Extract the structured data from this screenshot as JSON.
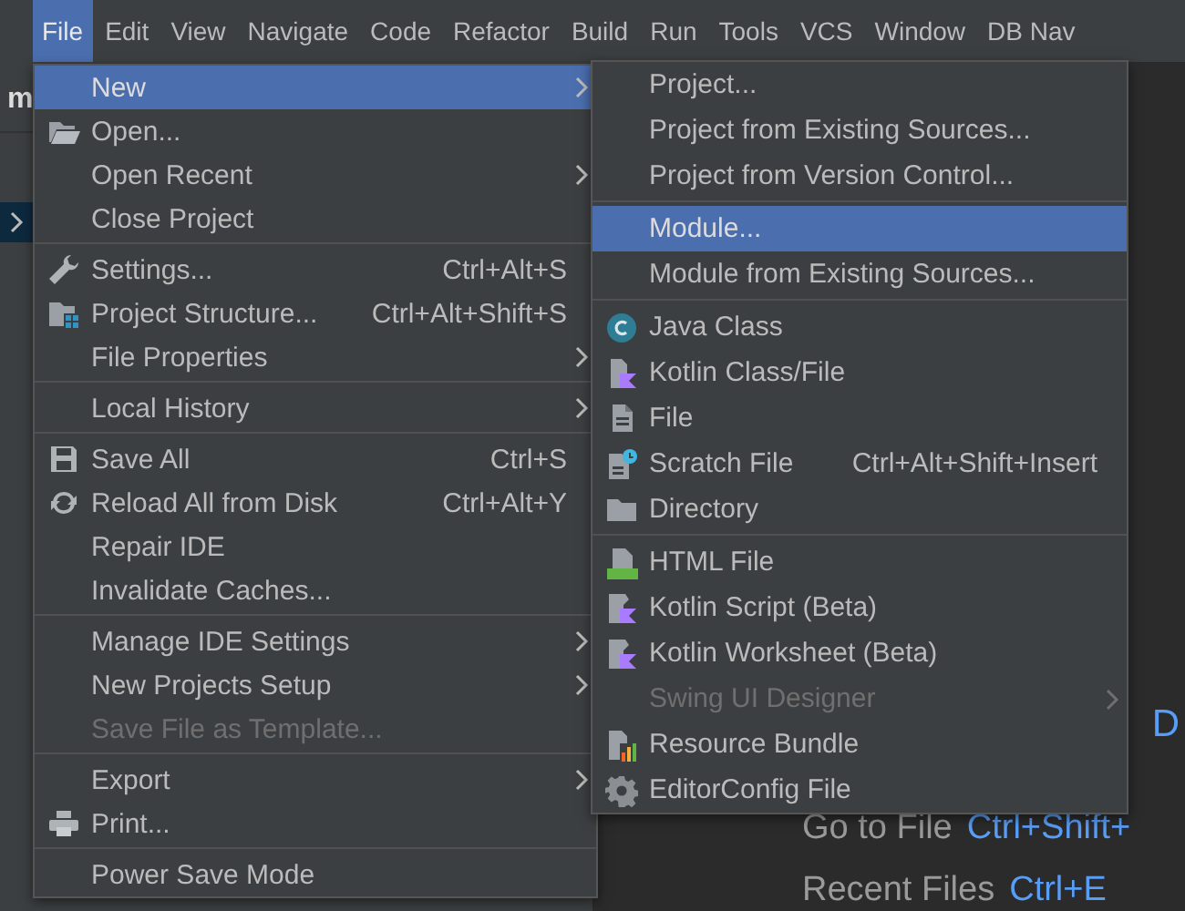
{
  "menu_bar": [
    {
      "label": "File",
      "selected": true
    },
    {
      "label": "Edit",
      "selected": false
    },
    {
      "label": "View",
      "selected": false
    },
    {
      "label": "Navigate",
      "selected": false
    },
    {
      "label": "Code",
      "selected": false
    },
    {
      "label": "Refactor",
      "selected": false
    },
    {
      "label": "Build",
      "selected": false
    },
    {
      "label": "Run",
      "selected": false
    },
    {
      "label": "Tools",
      "selected": false
    },
    {
      "label": "VCS",
      "selected": false
    },
    {
      "label": "Window",
      "selected": false
    },
    {
      "label": "DB Nav",
      "selected": false
    }
  ],
  "project_panel": {
    "title": "m"
  },
  "file_menu": [
    {
      "kind": "item",
      "label": "New",
      "submenu": true,
      "selected": true,
      "disabled": false
    },
    {
      "kind": "item",
      "label": "Open...",
      "selected": false,
      "disabled": false
    },
    {
      "kind": "item",
      "label": "Open Recent",
      "submenu": true,
      "selected": false,
      "disabled": false
    },
    {
      "kind": "item",
      "label": "Close Project",
      "selected": false,
      "disabled": false
    },
    {
      "kind": "separator"
    },
    {
      "kind": "item",
      "label": "Settings...",
      "shortcut": "Ctrl+Alt+S",
      "selected": false,
      "disabled": false
    },
    {
      "kind": "item",
      "label": "Project Structure...",
      "shortcut": "Ctrl+Alt+Shift+S",
      "selected": false,
      "disabled": false
    },
    {
      "kind": "item",
      "label": "File Properties",
      "submenu": true,
      "selected": false,
      "disabled": false
    },
    {
      "kind": "separator"
    },
    {
      "kind": "item",
      "label": "Local History",
      "submenu": true,
      "selected": false,
      "disabled": false
    },
    {
      "kind": "separator"
    },
    {
      "kind": "item",
      "label": "Save All",
      "shortcut": "Ctrl+S",
      "selected": false,
      "disabled": false
    },
    {
      "kind": "item",
      "label": "Reload All from Disk",
      "shortcut": "Ctrl+Alt+Y",
      "selected": false,
      "disabled": false
    },
    {
      "kind": "item",
      "label": "Repair IDE",
      "selected": false,
      "disabled": false
    },
    {
      "kind": "item",
      "label": "Invalidate Caches...",
      "selected": false,
      "disabled": false
    },
    {
      "kind": "separator"
    },
    {
      "kind": "item",
      "label": "Manage IDE Settings",
      "submenu": true,
      "selected": false,
      "disabled": false
    },
    {
      "kind": "item",
      "label": "New Projects Setup",
      "submenu": true,
      "selected": false,
      "disabled": false
    },
    {
      "kind": "item",
      "label": "Save File as Template...",
      "selected": false,
      "disabled": true
    },
    {
      "kind": "separator"
    },
    {
      "kind": "item",
      "label": "Export",
      "submenu": true,
      "selected": false,
      "disabled": false
    },
    {
      "kind": "item",
      "label": "Print...",
      "selected": false,
      "disabled": false
    },
    {
      "kind": "separator"
    },
    {
      "kind": "item",
      "label": "Power Save Mode",
      "selected": false,
      "disabled": false
    }
  ],
  "new_submenu": [
    {
      "kind": "item",
      "label": "Project...",
      "selected": false,
      "disabled": false
    },
    {
      "kind": "item",
      "label": "Project from Existing Sources...",
      "selected": false,
      "disabled": false
    },
    {
      "kind": "item",
      "label": "Project from Version Control...",
      "selected": false,
      "disabled": false
    },
    {
      "kind": "separator"
    },
    {
      "kind": "item",
      "label": "Module...",
      "selected": true,
      "disabled": false
    },
    {
      "kind": "item",
      "label": "Module from Existing Sources...",
      "selected": false,
      "disabled": false
    },
    {
      "kind": "separator"
    },
    {
      "kind": "item",
      "label": "Java Class",
      "selected": false,
      "disabled": false
    },
    {
      "kind": "item",
      "label": "Kotlin Class/File",
      "selected": false,
      "disabled": false
    },
    {
      "kind": "item",
      "label": "File",
      "selected": false,
      "disabled": false
    },
    {
      "kind": "item",
      "label": "Scratch File",
      "shortcut": "Ctrl+Alt+Shift+Insert",
      "selected": false,
      "disabled": false
    },
    {
      "kind": "item",
      "label": "Directory",
      "selected": false,
      "disabled": false
    },
    {
      "kind": "separator"
    },
    {
      "kind": "item",
      "label": "HTML File",
      "selected": false,
      "disabled": false
    },
    {
      "kind": "item",
      "label": "Kotlin Script (Beta)",
      "selected": false,
      "disabled": false
    },
    {
      "kind": "item",
      "label": "Kotlin Worksheet (Beta)",
      "selected": false,
      "disabled": false
    },
    {
      "kind": "item",
      "label": "Swing UI Designer",
      "submenu": true,
      "selected": false,
      "disabled": true
    },
    {
      "kind": "item",
      "label": "Resource Bundle",
      "selected": false,
      "disabled": false
    },
    {
      "kind": "item",
      "label": "EditorConfig File",
      "selected": false,
      "disabled": false
    }
  ],
  "editor_hints": [
    {
      "kind": "cut",
      "label": "D"
    },
    {
      "kind": "hint",
      "label": "Go to File",
      "shortcut": "Ctrl+Shift+"
    },
    {
      "kind": "hint",
      "label": "Recent Files",
      "shortcut": "Ctrl+E"
    }
  ]
}
